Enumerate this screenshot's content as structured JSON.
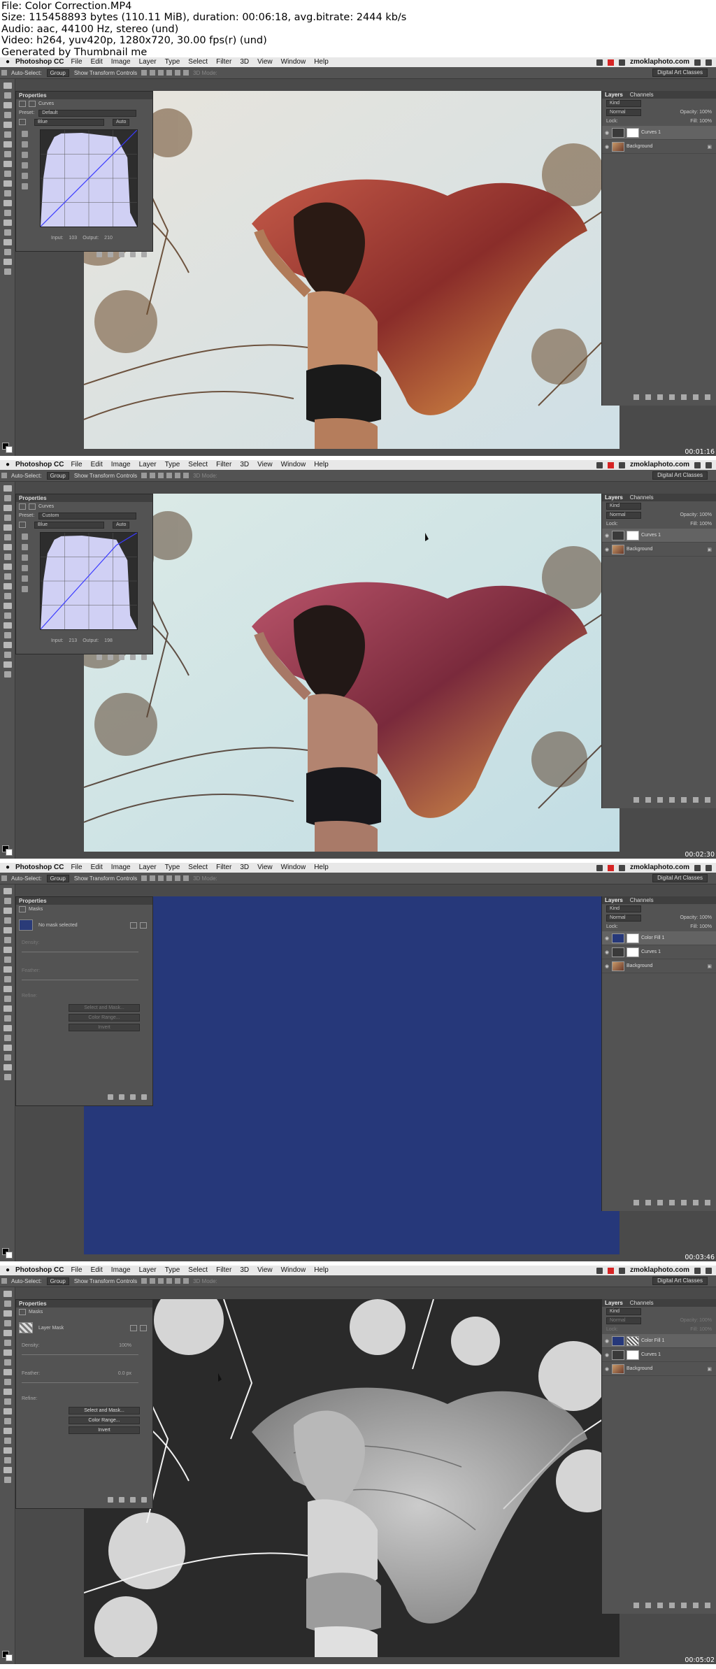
{
  "meta": {
    "file": "File: Color Correction.MP4",
    "size": "Size: 115458893 bytes (110.11 MiB), duration: 00:06:18, avg.bitrate: 2444 kb/s",
    "audio": "Audio: aac, 44100 Hz, stereo (und)",
    "video": "Video: h264, yuv420p, 1280x720, 30.00 fps(r) (und)",
    "generated": "Generated by Thumbnail me"
  },
  "app": {
    "name": "Photoshop CC",
    "menu": [
      "File",
      "Edit",
      "Image",
      "Layer",
      "Type",
      "Select",
      "Filter",
      "3D",
      "View",
      "Window",
      "Help"
    ],
    "site": "zmoklaphoto.com",
    "options": {
      "auto_select": "Auto-Select:",
      "group": "Group",
      "transform": "Show Transform Controls",
      "mode3d": "3D Mode:",
      "workspace": "Digital Art Classes"
    }
  },
  "layers_panel": {
    "tabs": [
      "Layers",
      "Channels"
    ],
    "kind": "Kind",
    "blend": "Normal",
    "opacity": "Opacity: 100%",
    "lock": "Lock:",
    "fill": "Fill: 100%"
  },
  "properties": {
    "title": "Properties",
    "curves_label": "Curves",
    "preset_label": "Preset:",
    "channel": "Blue",
    "auto": "Auto",
    "input_label": "Input:",
    "output_label": "Output:",
    "masks_label": "Masks",
    "no_mask": "No mask selected",
    "layer_mask": "Layer Mask",
    "density": "Density:",
    "feather": "Feather:",
    "refine": "Refine:",
    "select_mask": "Select and Mask...",
    "color_range": "Color Range...",
    "invert": "Invert"
  },
  "frames": [
    {
      "timestamp": "00:01:16",
      "preset": "Default",
      "input": "103",
      "output": "210",
      "layers": [
        "Curves 1",
        "Background"
      ]
    },
    {
      "timestamp": "00:02:30",
      "preset": "Custom",
      "input": "213",
      "output": "198",
      "layers": [
        "Curves 1",
        "Background"
      ]
    },
    {
      "timestamp": "00:03:46",
      "layers": [
        "Color Fill 1",
        "Curves 1",
        "Background"
      ],
      "canvas_color": "#26387a"
    },
    {
      "timestamp": "00:05:02",
      "density_value": "100%",
      "feather_value": "0.0 px",
      "layers": [
        "Color Fill 1",
        "Curves 1",
        "Background"
      ]
    }
  ]
}
